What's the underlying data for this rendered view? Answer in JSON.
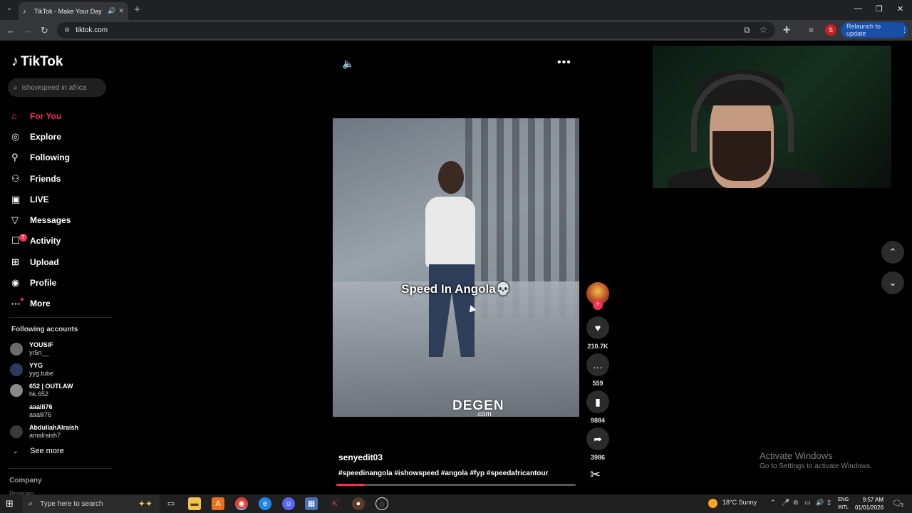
{
  "browser": {
    "tab_title": "TikTok - Make Your Day",
    "url": "tiktok.com",
    "relaunch_label": "Relaunch to update",
    "profile_initial": "S"
  },
  "tiktok": {
    "logo": "TikTok",
    "search_placeholder": "ishowspeed in africa",
    "nav": [
      {
        "label": "For You",
        "icon": "home-icon"
      },
      {
        "label": "Explore",
        "icon": "compass-icon"
      },
      {
        "label": "Following",
        "icon": "following-icon"
      },
      {
        "label": "Friends",
        "icon": "friends-icon"
      },
      {
        "label": "LIVE",
        "icon": "live-icon"
      },
      {
        "label": "Messages",
        "icon": "messages-icon"
      },
      {
        "label": "Activity",
        "icon": "activity-icon",
        "badge": "7"
      },
      {
        "label": "Upload",
        "icon": "upload-icon"
      },
      {
        "label": "Profile",
        "icon": "profile-icon"
      },
      {
        "label": "More",
        "icon": "more-icon"
      }
    ],
    "following_title": "Following accounts",
    "following": [
      {
        "name": "YOUSIF",
        "user": "yr5n__"
      },
      {
        "name": "YYG",
        "user": "yyg.tube"
      },
      {
        "name": "652 | OUTLAW",
        "user": "hk.652"
      },
      {
        "name": "aaalli76",
        "user": "aaalli76"
      },
      {
        "name": "AbdullahAlraish",
        "user": "amalraish7"
      }
    ],
    "see_more": "See more",
    "company": "Company",
    "program": "Program",
    "video": {
      "caption": "Speed In Angola💀",
      "watermark": "DEGEN",
      "watermark_sub": ".com",
      "author": "senyedit03",
      "hashtags": "#speedinangola #ishowspeed #angola #fyp #speedafricantour",
      "progress_fraction": 0.12
    },
    "actions": {
      "likes": "210.7K",
      "comments": "559",
      "saves": "9884",
      "shares": "3986"
    }
  },
  "windows": {
    "activate_title": "Activate Windows",
    "activate_sub": "Go to Settings to activate Windows.",
    "search_placeholder": "Type here to search",
    "weather": "18°C  Sunny",
    "lang_top": "ENG",
    "lang_bottom": "INTL",
    "time": "9:57 AM",
    "date": "01/01/2026",
    "notif_count": "3"
  },
  "colors": {
    "accent": "#fe2c55",
    "chrome_bg": "#202124",
    "relaunch": "#174ea6"
  }
}
